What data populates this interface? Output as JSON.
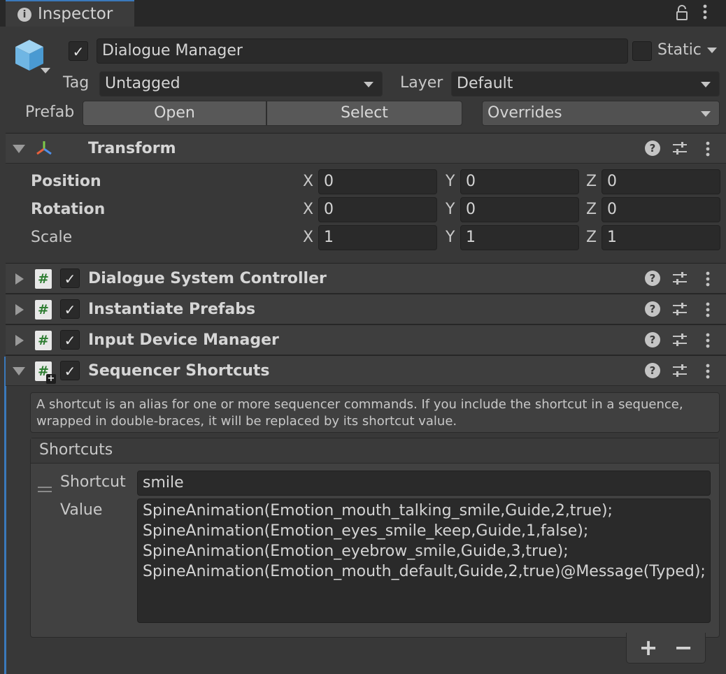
{
  "tab": {
    "title": "Inspector",
    "icon": "info-icon"
  },
  "object": {
    "name": "Dialogue Manager",
    "active": true,
    "static_label": "Static",
    "static_checked": false,
    "tag_label": "Tag",
    "tag_value": "Untagged",
    "layer_label": "Layer",
    "layer_value": "Default",
    "prefab_label": "Prefab",
    "open_label": "Open",
    "select_label": "Select",
    "overrides_label": "Overrides"
  },
  "transform": {
    "title": "Transform",
    "rows": [
      {
        "label": "Position",
        "x": "0",
        "y": "0",
        "z": "0"
      },
      {
        "label": "Rotation",
        "x": "0",
        "y": "0",
        "z": "0"
      },
      {
        "label": "Scale",
        "x": "1",
        "y": "1",
        "z": "1"
      }
    ],
    "axes": [
      "X",
      "Y",
      "Z"
    ]
  },
  "components": [
    {
      "title": "Dialogue System Controller",
      "expanded": false,
      "enabled": true
    },
    {
      "title": "Instantiate Prefabs",
      "expanded": false,
      "enabled": true
    },
    {
      "title": "Input Device Manager",
      "expanded": false,
      "enabled": true
    },
    {
      "title": "Sequencer Shortcuts",
      "expanded": true,
      "enabled": true
    }
  ],
  "sequencer": {
    "help_text": "A shortcut is an alias for one or more sequencer commands. If you include the shortcut in a sequence, wrapped in double-braces, it will be replaced by its shortcut value.",
    "list_header": "Shortcuts",
    "shortcut_label": "Shortcut",
    "shortcut_value": "smile",
    "value_label": "Value",
    "value_lines": [
      "SpineAnimation(Emotion_mouth_talking_smile,Guide,2,true);",
      "SpineAnimation(Emotion_eyes_smile_keep,Guide,1,false);",
      "SpineAnimation(Emotion_eyebrow_smile,Guide,3,true);",
      "SpineAnimation(Emotion_mouth_default,Guide,2,true)@Message(Typed);"
    ],
    "add_label": "+",
    "remove_label": "−"
  },
  "colors": {
    "accent": "#3a79bb",
    "background": "#383838",
    "script_hash": "#2e7d32"
  }
}
